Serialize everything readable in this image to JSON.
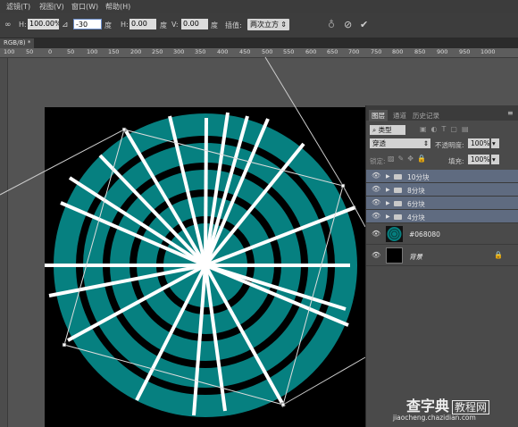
{
  "menu": {
    "items": [
      "滤镜(T)",
      "视图(V)",
      "窗口(W)",
      "帮助(H)"
    ]
  },
  "options": {
    "h_scale_label": "H:",
    "h_scale_value": "100.00%",
    "angle_value": "-30",
    "angle_unit": "度",
    "skew_h_label": "H:",
    "skew_h_value": "0.00",
    "skew_h_unit": "度",
    "skew_v_label": "V:",
    "skew_v_value": "0.00",
    "skew_v_unit": "度",
    "interp_label": "插值:",
    "interp_value": "两次立方"
  },
  "document": {
    "tab_label": "RGB/8) *"
  },
  "ruler": {
    "ticks": [
      "100",
      "50",
      "0",
      "50",
      "100",
      "150",
      "200",
      "250",
      "300",
      "350",
      "400",
      "450",
      "500",
      "550",
      "600",
      "650",
      "700",
      "750",
      "800",
      "850",
      "900",
      "950",
      "1000"
    ]
  },
  "panel": {
    "tabs": [
      "图层",
      "通道",
      "历史记录"
    ],
    "filter_label": "类型",
    "blend_mode": "穿透",
    "opacity_label": "不透明度:",
    "opacity_value": "100%",
    "lock_label": "锁定:",
    "fill_label": "填充:",
    "fill_value": "100%",
    "layers": [
      {
        "name": "10分块",
        "kind": "group"
      },
      {
        "name": "8分块",
        "kind": "group"
      },
      {
        "name": "6分块",
        "kind": "group"
      },
      {
        "name": "4分块",
        "kind": "group"
      },
      {
        "name": "#068080",
        "kind": "image"
      },
      {
        "name": "背景",
        "kind": "background"
      }
    ]
  },
  "watermark": {
    "brand": "查字典",
    "tagline": "教程网",
    "url": "jiaocheng.chazidian.com"
  },
  "colors": {
    "teal": "#068080",
    "canvas_bg": "#000000",
    "selected_group": "#5f6b80"
  }
}
